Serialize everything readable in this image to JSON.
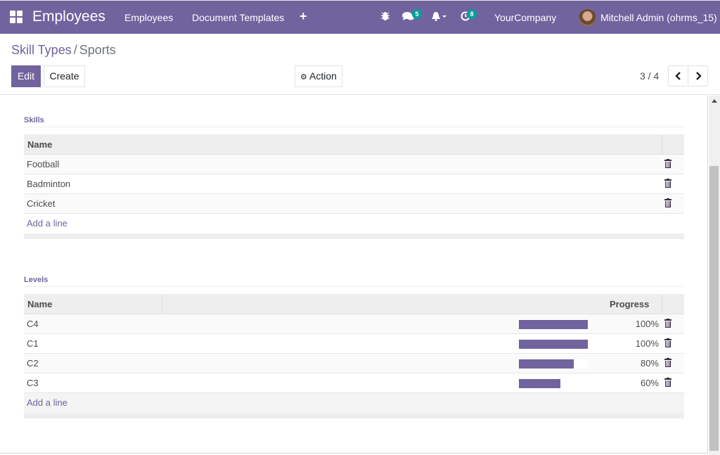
{
  "navbar": {
    "app_title": "Employees",
    "menu": [
      "Employees",
      "Document Templates"
    ],
    "plus_icon": "+",
    "icons": {
      "debug": "bug-icon",
      "messages": "chat-icon",
      "notifications": "bell-icon",
      "activities": "clock-icon"
    },
    "messages_badge": "5",
    "activities_badge": "8",
    "company": "YourCompany",
    "user": "Mitchell Admin (ohrms_15)"
  },
  "control_panel": {
    "breadcrumb_parent": "Skill Types",
    "breadcrumb_separator": "/",
    "breadcrumb_current": "Sports",
    "edit_label": "Edit",
    "create_label": "Create",
    "action_label": "Action",
    "pager": "3 / 4"
  },
  "skills": {
    "title": "Skills",
    "header_name": "Name",
    "rows": [
      {
        "name": "Football"
      },
      {
        "name": "Badminton"
      },
      {
        "name": "Cricket"
      }
    ],
    "add_line": "Add a line"
  },
  "levels": {
    "title": "Levels",
    "header_name": "Name",
    "header_progress": "Progress",
    "rows": [
      {
        "name": "C4",
        "progress": 100,
        "progress_label": "100%"
      },
      {
        "name": "C1",
        "progress": 100,
        "progress_label": "100%"
      },
      {
        "name": "C2",
        "progress": 80,
        "progress_label": "80%"
      },
      {
        "name": "C3",
        "progress": 60,
        "progress_label": "60%"
      }
    ],
    "add_line": "Add a line"
  },
  "colors": {
    "brand": "#71639e",
    "badge": "#00a09d"
  }
}
